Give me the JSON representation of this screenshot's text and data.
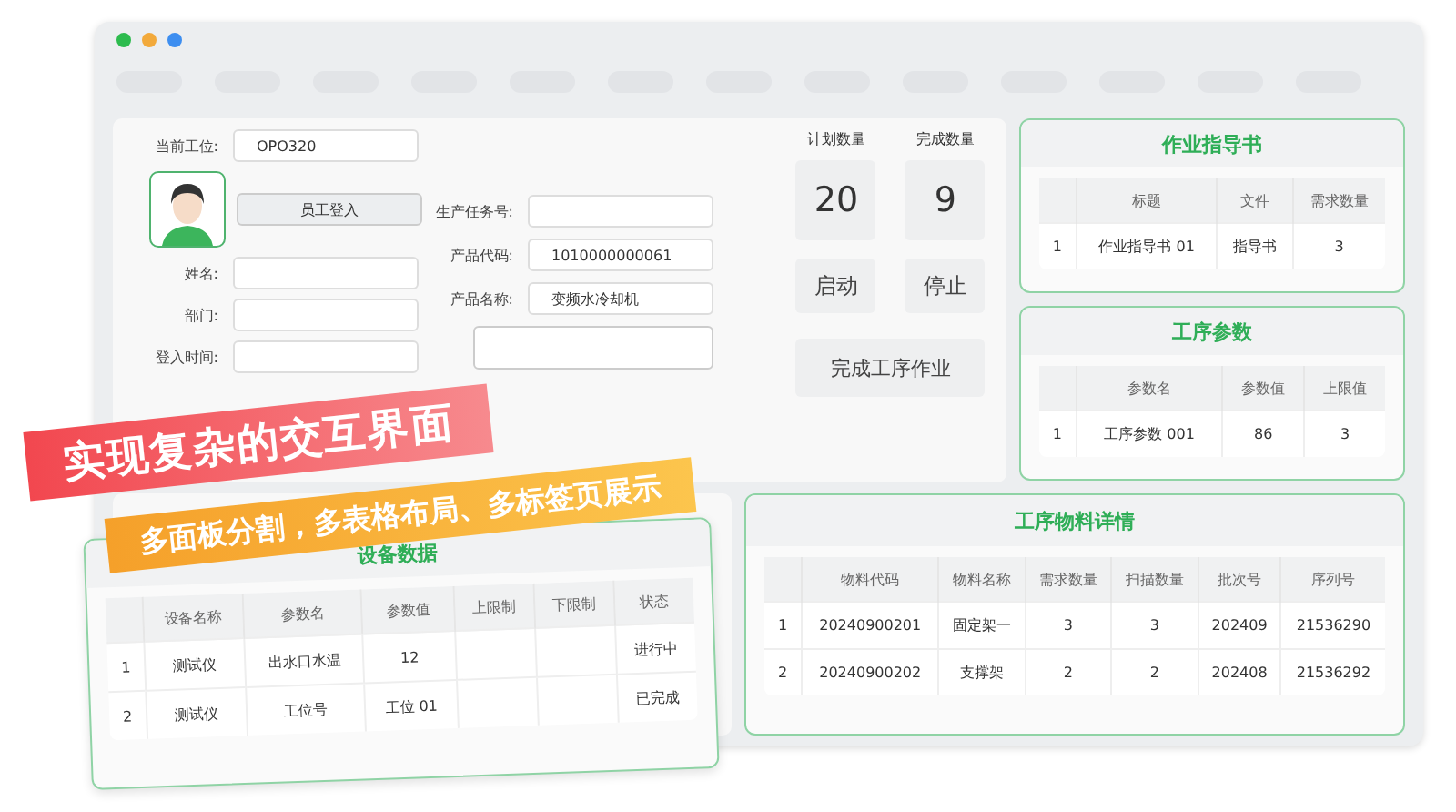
{
  "station_form": {
    "workstation": {
      "label": "当前工位:",
      "value": "OPO320"
    },
    "login_button": "员工登入",
    "employee_fields": [
      {
        "label": "姓名:"
      },
      {
        "label": "部门:"
      },
      {
        "label": "登入时间:"
      }
    ],
    "task_fields": [
      {
        "label": "生产任务号:"
      },
      {
        "label": "产品代码:",
        "value": "1010000000061"
      },
      {
        "label": "产品名称:",
        "value": "变频水冷却机"
      }
    ],
    "counters": [
      {
        "label": "计划数量",
        "value": "20"
      },
      {
        "label": "完成数量",
        "value": "9"
      }
    ],
    "buttons": [
      "启动",
      "停止"
    ],
    "finish_button": "完成工序作业"
  },
  "work_instructions": {
    "title": "作业指导书",
    "columns": [
      "",
      "标题",
      "文件",
      "需求数量"
    ],
    "rows": [
      [
        "1",
        "作业指导书 01",
        "指导书",
        "3"
      ]
    ]
  },
  "process_params": {
    "title": "工序参数",
    "columns": [
      "",
      "参数名",
      "参数值",
      "上限值"
    ],
    "rows": [
      [
        "1",
        "工序参数 001",
        "86",
        "3"
      ]
    ]
  },
  "material_details": {
    "title": "工序物料详情",
    "columns": [
      "",
      "物料代码",
      "物料名称",
      "需求数量",
      "扫描数量",
      "批次号",
      "序列号"
    ],
    "rows": [
      [
        "1",
        "20240900201",
        "固定架一",
        "3",
        "3",
        "202409",
        "21536290"
      ],
      [
        "2",
        "20240900202",
        "支撑架",
        "2",
        "2",
        "202408",
        "21536292"
      ]
    ]
  },
  "device_data": {
    "title": "设备数据",
    "columns": [
      "",
      "设备名称",
      "参数名",
      "参数值",
      "上限制",
      "下限制",
      "状态"
    ],
    "rows": [
      [
        "1",
        "测试仪",
        "出水口水温",
        "12",
        "",
        "",
        "进行中"
      ],
      [
        "2",
        "测试仪",
        "工位号",
        "工位 01",
        "",
        "",
        "已完成"
      ]
    ]
  },
  "banners": [
    {
      "kind": "headline",
      "text": "实现复杂的交互界面"
    },
    {
      "kind": "subline",
      "text": "多面板分割，多表格布局、多标签页展示"
    }
  ]
}
